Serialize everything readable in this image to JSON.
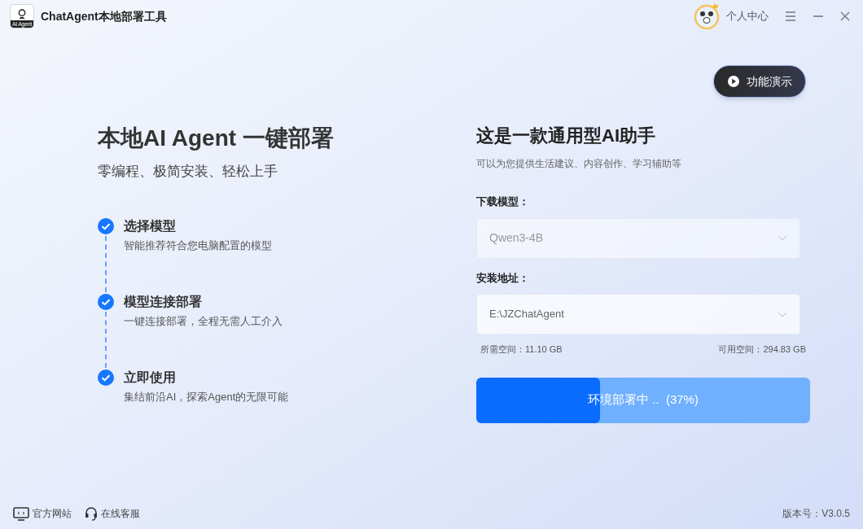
{
  "window": {
    "title": "ChatAgent本地部署工具",
    "logo_text": "AI Agent",
    "user_label": "个人中心"
  },
  "demo_button": "功能演示",
  "hero": {
    "title": "本地AI Agent 一键部署",
    "subtitle": "零编程、极简安装、轻松上手"
  },
  "steps": [
    {
      "title": "选择模型",
      "description": "智能推荐符合您电脑配置的模型",
      "checked": true
    },
    {
      "title": "模型连接部署",
      "description": "一键连接部署，全程无需人工介入",
      "checked": true
    },
    {
      "title": "立即使用",
      "description": "集结前沿AI，探索Agent的无限可能",
      "checked": true
    }
  ],
  "panel": {
    "title": "这是一款通用型AI助手",
    "subtitle": "可以为您提供生活建议、内容创作、学习辅助等",
    "model_label": "下载模型：",
    "model_value": "Qwen3-4B",
    "model_disabled": true,
    "path_label": "安装地址：",
    "path_value": "E:\\JZChatAgent",
    "required_space": "所需空间：11.10 GB",
    "available_space": "可用空间：294.83 GB"
  },
  "progress": {
    "label": "环境部署中 ..  (37%)",
    "level": 0.37
  },
  "footer": {
    "links": [
      {
        "kind": "website",
        "label": "官方网站"
      },
      {
        "kind": "support",
        "label": "在线客服"
      }
    ],
    "version": "版本号：V3.0.5"
  }
}
